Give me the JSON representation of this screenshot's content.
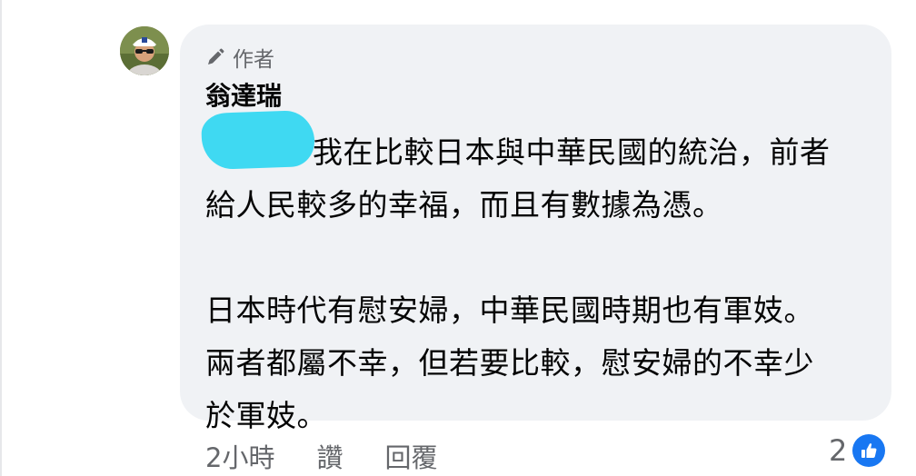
{
  "comment": {
    "author_badge": "作者",
    "author_name": "翁達瑞",
    "paragraphs": [
      [
        "我在比較日本與中華民國的統治，前者",
        "給人民較多的幸福，而且有數據為憑。"
      ],
      [
        "日本時代有慰安婦，中華民國時期也有軍妓。",
        "兩者都屬不幸，但若要比較，慰安婦的不幸少",
        "於軍妓。"
      ]
    ],
    "icons": {
      "author_badge": "pencil-icon",
      "reaction": "thumbs-up-icon"
    }
  },
  "actions": {
    "time": "2小時",
    "like": "讚",
    "reply": "回覆"
  },
  "reactions": {
    "count": "2"
  },
  "colors": {
    "bubble": "#f0f2f5",
    "secondary_text": "#65676b",
    "like_blue": "#1877f2",
    "redaction": "#3fd9f2"
  }
}
